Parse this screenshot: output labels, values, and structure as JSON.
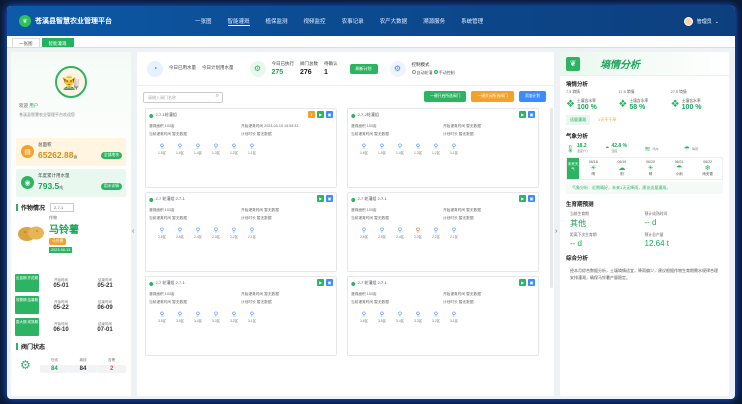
{
  "app": {
    "title": "苍溪县智慧农业管理平台",
    "logo_icon": "leaf-icon"
  },
  "nav": [
    "一张图",
    "智能灌溉",
    "植保监测",
    "视频监控",
    "农事记录",
    "农产大数据",
    "溯源服务",
    "系统管理"
  ],
  "user": {
    "name": "管理员"
  },
  "tabs": [
    "一张图",
    "智能灌溉"
  ],
  "profile": {
    "welcome": "欢迎",
    "username": "用户",
    "intro": "苍溪县智慧农业管理平台欢迎您",
    "area_label": "总面积",
    "area_value": "65262.88",
    "area_unit": "亩",
    "area_btn": "全部地块",
    "rain_label": "年度累计用水量",
    "rain_value": "793.5",
    "rain_unit": "吨",
    "rain_btn": "用水详情"
  },
  "crop": {
    "section": "作物情况",
    "select": "2-7-1",
    "name": "马铃薯",
    "tag": "马铃薯",
    "date": "2023-06-13",
    "stages": [
      {
        "btn": "出苗期 开花期",
        "a_label": "开始时间",
        "a_date": "05-01",
        "b_label": "结束时间",
        "b_date": "05-21"
      },
      {
        "btn": "现蕾期 结薯期",
        "a_label": "开始时间",
        "a_date": "05-22",
        "b_label": "结束时间",
        "b_date": "06-09"
      },
      {
        "btn": "膨大期 成熟期",
        "a_label": "开始时间",
        "a_date": "06-10",
        "b_label": "结束时间",
        "b_date": "07-01"
      }
    ]
  },
  "devices": {
    "section": "阀门状态",
    "online_label": "在线",
    "online": "84",
    "offline_label": "离线",
    "offline": "84",
    "alarm_label": "告警",
    "alarm": "2"
  },
  "summary": {
    "today_label": "今日已用水量",
    "today": "",
    "plan_label": "今日计划用水量",
    "plan": "",
    "valves_label": "今日已执行",
    "valves_value": "275",
    "total_label": "阀门总数",
    "total_value": "276",
    "count_label": "待确认",
    "count_value": "1",
    "refresh": "刷新计划",
    "mode_label": "控制模式",
    "mode_auto": "自动轮灌",
    "mode_manual": "手动控制"
  },
  "toolbar": {
    "search_placeholder": "请输入阀门名称",
    "btn1": "一键开启所选阀门",
    "btn2": "一键关闭所选阀门",
    "btn3": "添加计划"
  },
  "valve_cards": [
    {
      "title": "2-7-1轮灌组",
      "area": "灌溉面积 103亩",
      "time": "开始灌溉时间 2023-03-10 15:55:33",
      "s1": "当前灌溉时间 暂无数据",
      "s2": "计划时长 暂无数据",
      "valves": [
        "1-6区",
        "1-5区",
        "1-4区",
        "1-3区",
        "1-2区",
        "1-1区"
      ]
    },
    {
      "title": "2-7-2轮灌组",
      "area": "灌溉面积 103亩",
      "time": "开始灌溉时间 暂无数据",
      "s1": "当前灌溉时间 暂无数据",
      "s2": "计划时长 暂无数据",
      "valves": [
        "1-6区",
        "1-5区",
        "1-4区",
        "1-3区",
        "1-2区",
        "1-1区"
      ]
    },
    {
      "title": "2-7 轮灌组 2-7-1",
      "area": "灌溉面积 103亩",
      "time": "开始灌溉时间 暂无数据",
      "s1": "当前灌溉时间 暂无数据",
      "s2": "计划时长 暂无数据",
      "valves": [
        "2-6区",
        "2-5区",
        "2-4区",
        "2-3区",
        "2-2区",
        "2-1区"
      ]
    },
    {
      "title": "2-7 轮灌组 2-7-1",
      "area": "灌溉面积 103亩",
      "time": "开始灌溉时间 暂无数据",
      "s1": "当前灌溉时间 暂无数据",
      "s2": "计划时长 暂无数据",
      "valves": [
        "2-6区",
        "2-5区",
        "2-4区",
        "2-3区",
        "2-2区",
        "2-1区"
      ]
    },
    {
      "title": "2-7 轮灌组 2-7-1",
      "area": "灌溉面积 103亩",
      "time": "开始灌溉时间 暂无数据",
      "s1": "当前灌溉时间 暂无数据",
      "s2": "计划时长 暂无数据",
      "valves": [
        "3-6区",
        "3-5区",
        "3-4区",
        "3-3区",
        "3-2区",
        "3-1区"
      ]
    },
    {
      "title": "2-7 轮灌组 2-7-1",
      "area": "灌溉面积 103亩",
      "time": "开始灌溉时间 暂无数据",
      "s1": "当前灌溉时间 暂无数据",
      "s2": "计划时长 暂无数据",
      "valves": [
        "3-6区",
        "3-5区",
        "3-4区",
        "3-3区",
        "3-2区",
        "3-1区"
      ]
    }
  ],
  "right": {
    "title": "墒情分析",
    "soil_section": "墒情分析",
    "soil": [
      {
        "depth": "7.5 墒情",
        "label": "土壤含水率",
        "value": "100 %"
      },
      {
        "depth": "17.5 墒情",
        "label": "土壤含水率",
        "value": "58 %"
      },
      {
        "depth": "27.5 墒情",
        "label": "土壤含水率",
        "value": "100 %"
      }
    ],
    "status_a": "适量灌溉",
    "status_b": "1天不干旱",
    "weather_section": "气象分析",
    "weather_now": [
      {
        "v": "18.2",
        "l": "温度(℃)"
      },
      {
        "v": "42.8 %",
        "l": "湿度"
      },
      {
        "v": "",
        "l": "风向"
      },
      {
        "v": "",
        "l": "降雨"
      }
    ],
    "forecast_label": "未来天气",
    "forecast": [
      {
        "d": "06/18",
        "w": "晴"
      },
      {
        "d": "06/19",
        "w": "阴"
      },
      {
        "d": "06/20",
        "w": "晴"
      },
      {
        "d": "06/21",
        "w": "小雨"
      },
      {
        "d": "06/22",
        "w": "雨夹雪"
      }
    ],
    "notice": "气象分析：近期晴好，未来1天无降雨，建议适量灌溉。",
    "grow_section": "生育期预测",
    "grow": [
      {
        "l": "当前生育期",
        "v": "其他"
      },
      {
        "l": "预计成熟时间",
        "v": "-- d"
      },
      {
        "l": "距离下次生育期",
        "v": "-- d"
      },
      {
        "l": "预计总产量",
        "v": "12.64 t"
      }
    ],
    "analysis_section": "综合分析",
    "analysis": "经本月综合数据分析，土壤墒情适宜，降雨偏少，建议根据作物生育期需水规律合理安排灌溉，确保马铃薯产量稳定。"
  }
}
